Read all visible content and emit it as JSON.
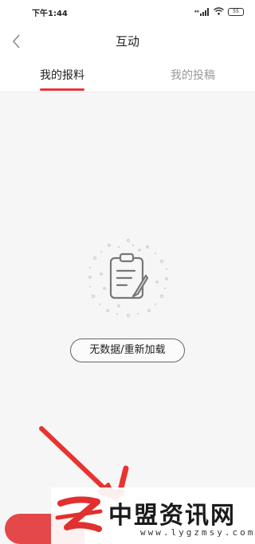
{
  "status_bar": {
    "time": "下午1:44",
    "signal": "⁴⁶",
    "battery": "55",
    "icons": [
      "signal-icon",
      "wifi-icon",
      "battery-icon"
    ]
  },
  "header": {
    "title": "互动",
    "back_icon": "chevron-left-icon"
  },
  "tabs": [
    {
      "label": "我的报料",
      "active": true
    },
    {
      "label": "我的投稿",
      "active": false
    }
  ],
  "empty_state": {
    "icon": "clipboard-edit-icon",
    "reload_label": "无数据/重新加载"
  },
  "colors": {
    "accent": "#e4393c",
    "tab_inactive": "#999999",
    "background": "#f6f6f6"
  },
  "watermark": {
    "name": "中盟资讯网",
    "url": "www.lygzmsy.com"
  }
}
